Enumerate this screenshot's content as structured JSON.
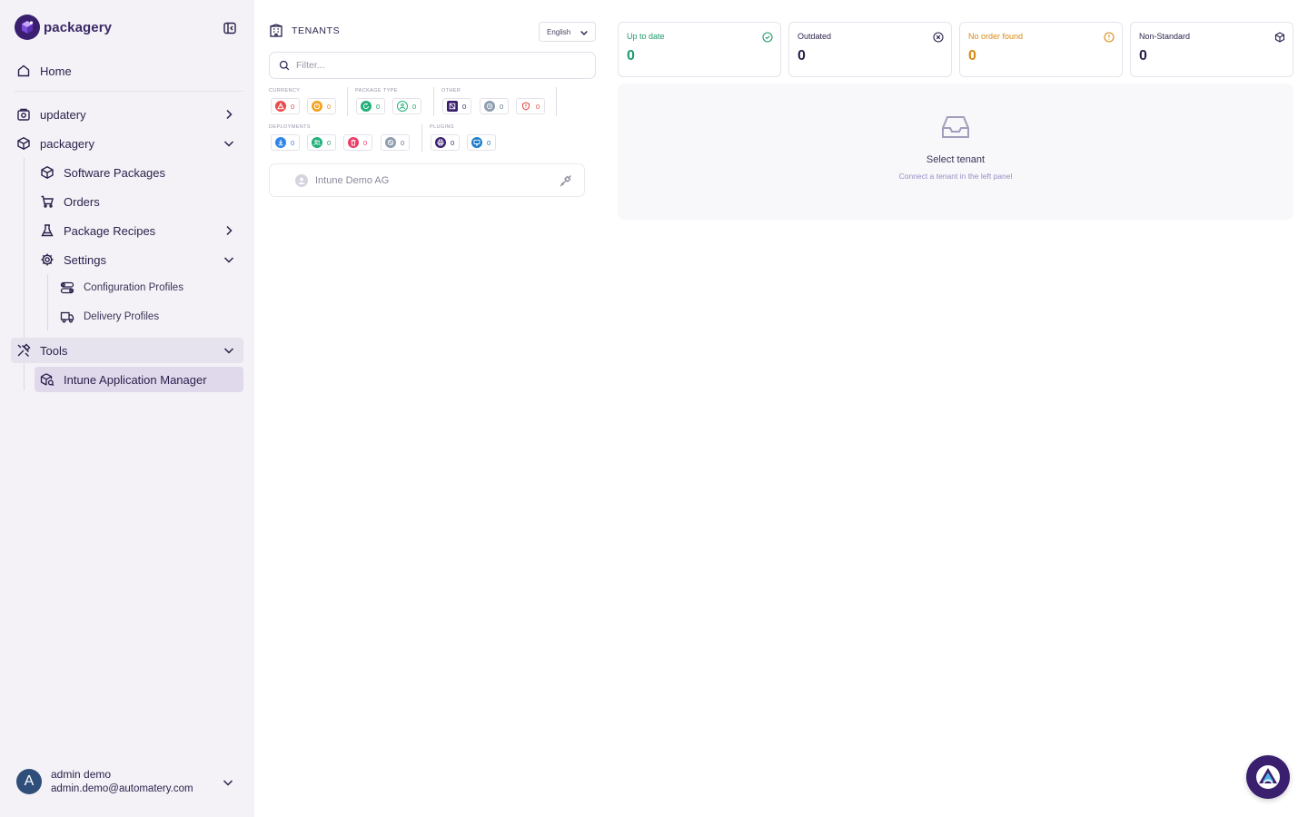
{
  "brand": {
    "name": "packagery"
  },
  "nav": {
    "home": "Home",
    "updatery": "updatery",
    "packagery": "packagery",
    "software_packages": "Software Packages",
    "orders": "Orders",
    "package_recipes": "Package Recipes",
    "settings": "Settings",
    "configuration_profiles": "Configuration Profiles",
    "delivery_profiles": "Delivery Profiles",
    "tools": "Tools",
    "intune_application_manager": "Intune Application Manager"
  },
  "user": {
    "initial": "A",
    "name": "admin demo",
    "email": "admin.demo@automatery.com"
  },
  "tenants": {
    "title": "TENANTS",
    "language": "English",
    "filter_placeholder": "Filter...",
    "groups": {
      "currency": "CURRENCY",
      "package_type": "PACKAGE TYPE",
      "other": "OTHER",
      "deployments": "DEPLOYMENTS",
      "plugins": "PLUGINS"
    },
    "chips": {
      "currency_critical": "0",
      "currency_warning": "0",
      "type_recipe": "0",
      "type_custom": "0",
      "other_blocked": "0",
      "other_pending": "0",
      "other_shield": "0",
      "deploy_download": "0",
      "deploy_users": "0",
      "deploy_delete": "0",
      "deploy_disabled": "0",
      "plugin_print": "0",
      "plugin_remote": "0"
    },
    "rows": [
      {
        "name": "Intune Demo AG"
      }
    ]
  },
  "stats": [
    {
      "label": "Up to date",
      "value": "0",
      "color": "#1c9b6b",
      "icon": "check-circle-icon"
    },
    {
      "label": "Outdated",
      "value": "0",
      "color": "#2a1f4a",
      "icon": "x-circle-icon"
    },
    {
      "label": "No order found",
      "value": "0",
      "color": "#d98a12",
      "icon": "alert-circle-icon"
    },
    {
      "label": "Non-Standard",
      "value": "0",
      "color": "#2a1f4a",
      "icon": "box-icon"
    }
  ],
  "empty_state": {
    "title": "Select tenant",
    "subtitle": "Connect a tenant in the left panel"
  },
  "colors": {
    "accent": "#3a1f6e",
    "sidebar_bg": "#f4f2f7",
    "active_bg": "#e0d9ec"
  }
}
